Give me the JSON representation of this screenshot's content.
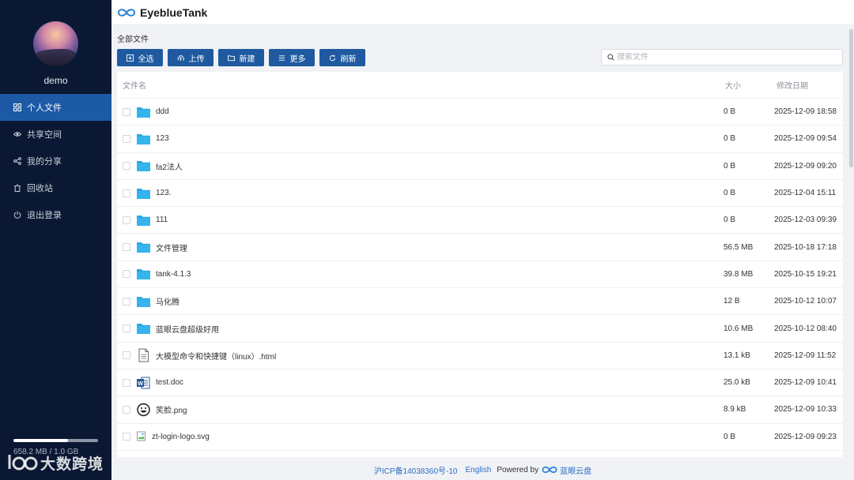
{
  "app": {
    "title": "EyeblueTank"
  },
  "user": {
    "name": "demo"
  },
  "sidebar": {
    "items": [
      {
        "label": "个人文件",
        "icon": "grid-icon",
        "active": true
      },
      {
        "label": "共享空间",
        "icon": "eye-icon",
        "active": false
      },
      {
        "label": "我的分享",
        "icon": "share-icon",
        "active": false
      },
      {
        "label": "回收站",
        "icon": "trash-icon",
        "active": false
      },
      {
        "label": "退出登录",
        "icon": "power-icon",
        "active": false
      }
    ],
    "quota": {
      "text": "658.2 MB / 1.0 GB",
      "used_fraction": 0.643
    },
    "watermark": "大数跨境"
  },
  "breadcrumb": "全部文件",
  "toolbar": {
    "select_all": "全选",
    "upload": "上传",
    "new": "新建",
    "more": "更多",
    "refresh": "刷新"
  },
  "search": {
    "placeholder": "搜索文件",
    "value": ""
  },
  "table": {
    "headers": {
      "name": "文件名",
      "size": "大小",
      "date": "修改日期"
    },
    "rows": [
      {
        "name": "ddd",
        "type": "folder",
        "size": "0 B",
        "date": "2025-12-09 18:58"
      },
      {
        "name": "123",
        "type": "folder",
        "size": "0 B",
        "date": "2025-12-09 09:54"
      },
      {
        "name": "fa2法人",
        "type": "folder",
        "size": "0 B",
        "date": "2025-12-09 09:20"
      },
      {
        "name": "123.",
        "type": "folder",
        "size": "0 B",
        "date": "2025-12-04 15:11"
      },
      {
        "name": "111",
        "type": "folder",
        "size": "0 B",
        "date": "2025-12-03 09:39"
      },
      {
        "name": "文件管理",
        "type": "folder",
        "size": "56.5 MB",
        "date": "2025-10-18 17:18"
      },
      {
        "name": "tank-4.1.3",
        "type": "folder",
        "size": "39.8 MB",
        "date": "2025-10-15 19:21"
      },
      {
        "name": "马化腾",
        "type": "folder",
        "size": "12 B",
        "date": "2025-10-12 10:07"
      },
      {
        "name": "蓝眼云盘超级好用",
        "type": "folder",
        "size": "10.6 MB",
        "date": "2025-10-12 08:40"
      },
      {
        "name": "大模型命令和快捷键（linux）.html",
        "type": "document",
        "size": "13.1 kB",
        "date": "2025-12-09 11:52"
      },
      {
        "name": "test.doc",
        "type": "word",
        "size": "25.0 kB",
        "date": "2025-12-09 10:41"
      },
      {
        "name": "笑脸.png",
        "type": "smiley",
        "size": "8.9 kB",
        "date": "2025-12-09 10:33"
      },
      {
        "name": "zt-login-logo.svg",
        "type": "broken-image",
        "size": "0 B",
        "date": "2025-12-09 09:23"
      }
    ]
  },
  "footer": {
    "icp": "沪ICP备14038360号-10",
    "lang": "English",
    "powered": "Powered by",
    "brand": "蓝眼云盘"
  },
  "colors": {
    "sidebar_bg": "#0a1833",
    "accent": "#1f5aa0",
    "active_nav": "#1d5aa6",
    "folder": "#29a7e1",
    "link": "#2c6fbf"
  }
}
